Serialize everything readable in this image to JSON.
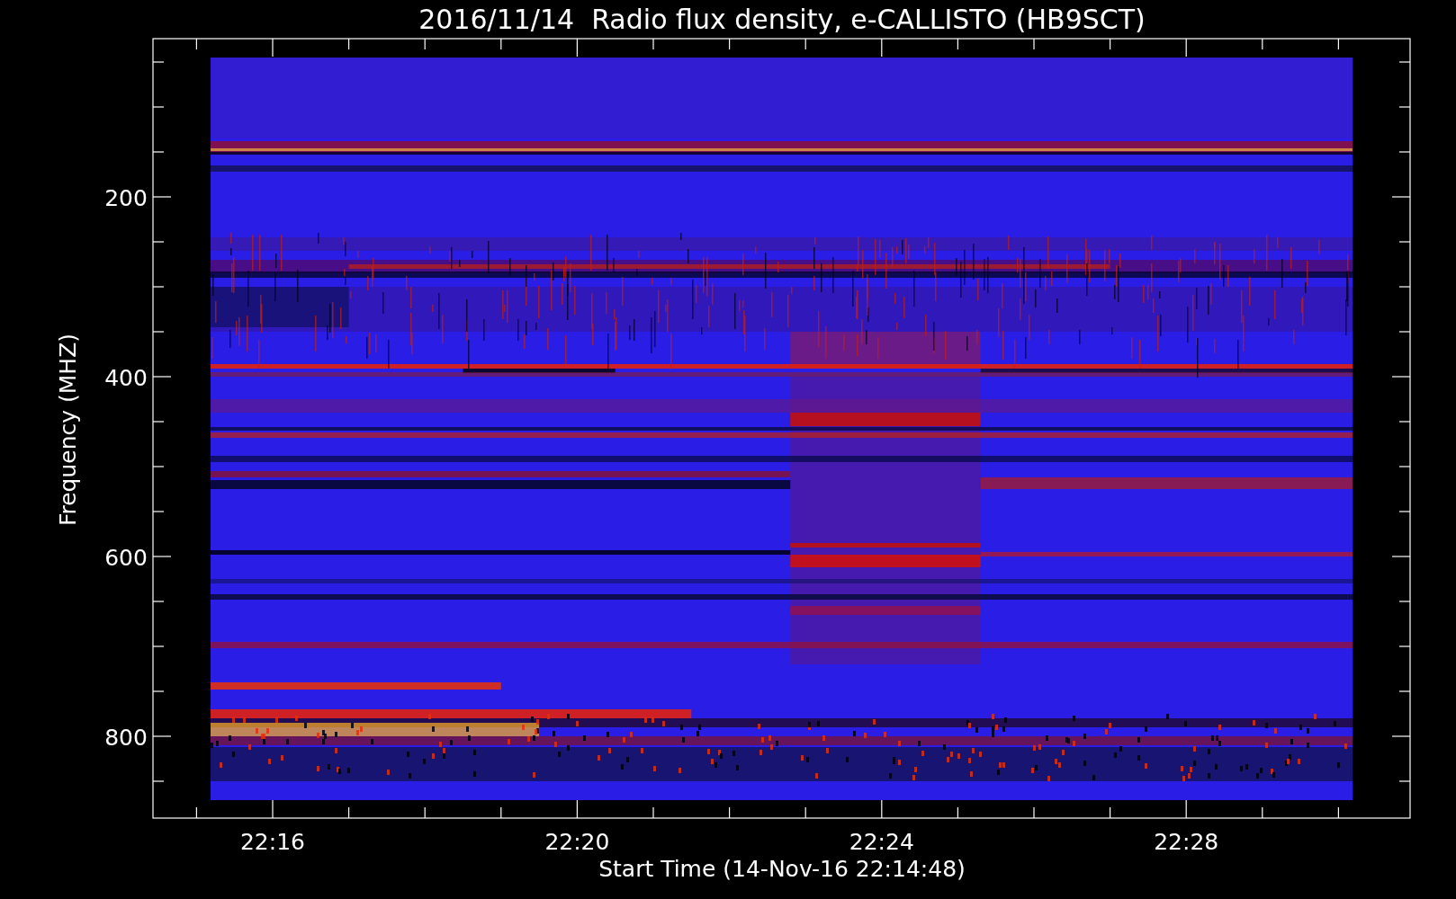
{
  "plot": {
    "title": "2016/11/14  Radio flux density, e-CALLISTO (HB9SCT)",
    "ylabel": "Frequency (MHZ)",
    "xlabel": "Start Time (14-Nov-16 22:14:48)",
    "yticks": [
      "200",
      "400",
      "600",
      "800"
    ],
    "xticks": [
      "22:16",
      "22:20",
      "22:24",
      "22:28"
    ]
  }
}
